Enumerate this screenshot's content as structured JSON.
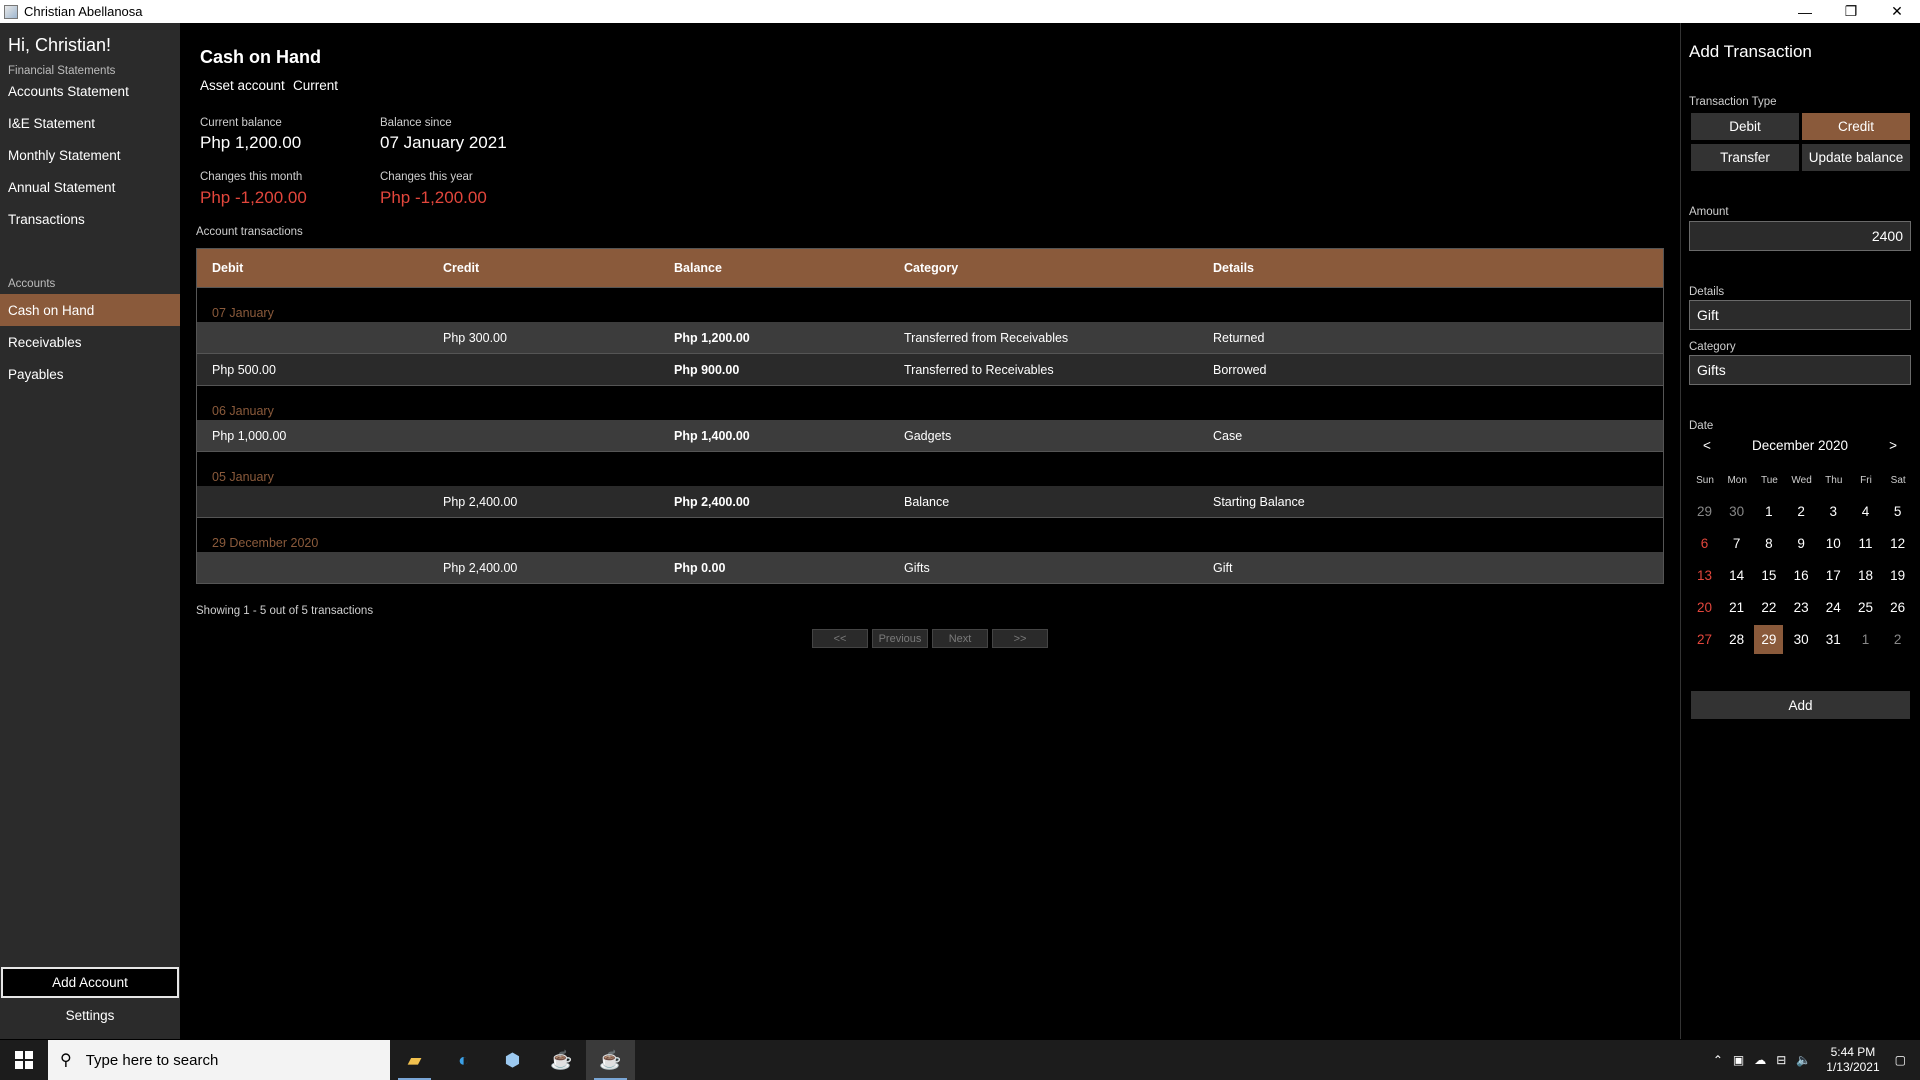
{
  "window": {
    "title": "Christian Abellanosa",
    "minimize": "—",
    "restore": "❐",
    "close": "✕"
  },
  "sidebar": {
    "greeting": "Hi, Christian!",
    "financial_label": "Financial Statements",
    "financial_items": [
      "Accounts Statement",
      "I&E Statement",
      "Monthly Statement",
      "Annual Statement",
      "Transactions"
    ],
    "accounts_label": "Accounts",
    "account_items": [
      "Cash on Hand",
      "Receivables",
      "Payables"
    ],
    "active_account": "Cash on Hand",
    "add_account": "Add Account",
    "settings": "Settings"
  },
  "account": {
    "name": "Cash on Hand",
    "type": "Asset account",
    "term": "Current",
    "current_balance_label": "Current balance",
    "current_balance": "Php 1,200.00",
    "balance_since_label": "Balance since",
    "balance_since": "07 January 2021",
    "changes_month_label": "Changes this month",
    "changes_month": "Php -1,200.00",
    "changes_year_label": "Changes this year",
    "changes_year": "Php -1,200.00"
  },
  "transactions": {
    "label": "Account transactions",
    "columns": [
      "Debit",
      "Credit",
      "Balance",
      "Category",
      "Details"
    ],
    "groups": [
      {
        "date": "07 January",
        "rows": [
          {
            "debit": "",
            "credit": "Php 300.00",
            "balance": "Php 1,200.00",
            "category": "Transferred from Receivables",
            "details": "Returned"
          },
          {
            "debit": "Php 500.00",
            "credit": "",
            "balance": "Php 900.00",
            "category": "Transferred to Receivables",
            "details": "Borrowed"
          }
        ]
      },
      {
        "date": "06 January",
        "rows": [
          {
            "debit": "Php 1,000.00",
            "credit": "",
            "balance": "Php 1,400.00",
            "category": "Gadgets",
            "details": "Case"
          }
        ]
      },
      {
        "date": "05 January",
        "rows": [
          {
            "debit": "",
            "credit": "Php 2,400.00",
            "balance": "Php 2,400.00",
            "category": "Balance",
            "details": "Starting Balance"
          }
        ]
      },
      {
        "date": "29 December 2020",
        "rows": [
          {
            "debit": "",
            "credit": "Php 2,400.00",
            "balance": "Php 0.00",
            "category": "Gifts",
            "details": "Gift"
          }
        ]
      }
    ],
    "showing": "Showing 1 - 5 out of 5 transactions",
    "pager": {
      "first": "<<",
      "previous": "Previous",
      "next": "Next",
      "last": ">>"
    }
  },
  "add_transaction": {
    "title": "Add Transaction",
    "type_label": "Transaction Type",
    "types": [
      "Debit",
      "Credit",
      "Transfer",
      "Update balance"
    ],
    "selected_type": "Credit",
    "amount_label": "Amount",
    "amount": "2400",
    "details_label": "Details",
    "details": "Gift",
    "category_label": "Category",
    "category": "Gifts",
    "date_label": "Date",
    "calendar": {
      "month": "December 2020",
      "prev": "<",
      "next": ">",
      "dow": [
        "Sun",
        "Mon",
        "Tue",
        "Wed",
        "Thu",
        "Fri",
        "Sat"
      ],
      "weeks": [
        [
          "29",
          "30",
          "1",
          "2",
          "3",
          "4",
          "5"
        ],
        [
          "6",
          "7",
          "8",
          "9",
          "10",
          "11",
          "12"
        ],
        [
          "13",
          "14",
          "15",
          "16",
          "17",
          "18",
          "19"
        ],
        [
          "20",
          "21",
          "22",
          "23",
          "24",
          "25",
          "26"
        ],
        [
          "27",
          "28",
          "29",
          "30",
          "31",
          "1",
          "2"
        ]
      ],
      "selected": "29"
    },
    "add": "Add"
  },
  "taskbar": {
    "search_placeholder": "Type here to search",
    "time": "5:44 PM",
    "date": "1/13/2021",
    "apps": [
      "file-explorer-icon",
      "edge-icon",
      "box-icon",
      "java-icon",
      "java-icon"
    ]
  },
  "colors": {
    "accent": "#8a5a3b",
    "negative": "#e2463c",
    "sidebar": "#2b2b2b"
  }
}
